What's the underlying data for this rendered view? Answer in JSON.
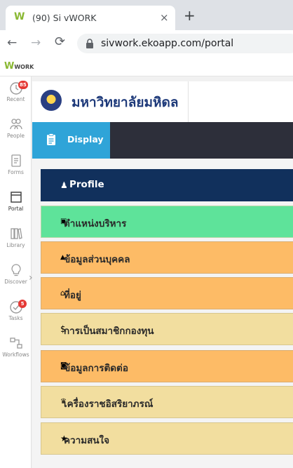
{
  "browser": {
    "tab_title": "(90) Si vWORK",
    "tab_close": "×",
    "new_tab": "+",
    "url": "sivwork.ekoapp.com/portal"
  },
  "app": {
    "logo_w": "W",
    "logo_text": "WORK"
  },
  "sidebar": {
    "items": [
      {
        "label": "Recent",
        "badge": "85"
      },
      {
        "label": "People"
      },
      {
        "label": "Forms"
      },
      {
        "label": "Portal"
      },
      {
        "label": "Library"
      },
      {
        "label": "Discover"
      },
      {
        "label": "Tasks",
        "badge": "5"
      },
      {
        "label": "Workflows"
      }
    ]
  },
  "header": {
    "university_name": "มหาวิทยาลัยมหิดล"
  },
  "display_bar": {
    "label": "Display"
  },
  "menu": {
    "items": [
      {
        "label": "Profile",
        "icon": "👤"
      },
      {
        "label": "ตำแหน่งบริหาร",
        "icon": "▣"
      },
      {
        "label": "ข้อมูลส่วนบุคคล",
        "icon": "▲"
      },
      {
        "label": "ที่อยู่",
        "icon": "⌂"
      },
      {
        "label": "การเป็นสมาชิกกองทุน",
        "icon": "$"
      },
      {
        "label": "ข้อมูลการติดต่อ",
        "icon": "◙"
      },
      {
        "label": "เครื่องราชอิสริยาภรณ์",
        "icon": "♛"
      },
      {
        "label": "ความสนใจ",
        "icon": "★"
      }
    ]
  },
  "colors": {
    "profile_bg": "#11305c",
    "green_bg": "#5ee39a",
    "orange_bg": "#fdbb66",
    "beige_bg": "#f2de9f",
    "display_btn": "#2fa4d8",
    "display_bar": "#2d2f3a"
  }
}
